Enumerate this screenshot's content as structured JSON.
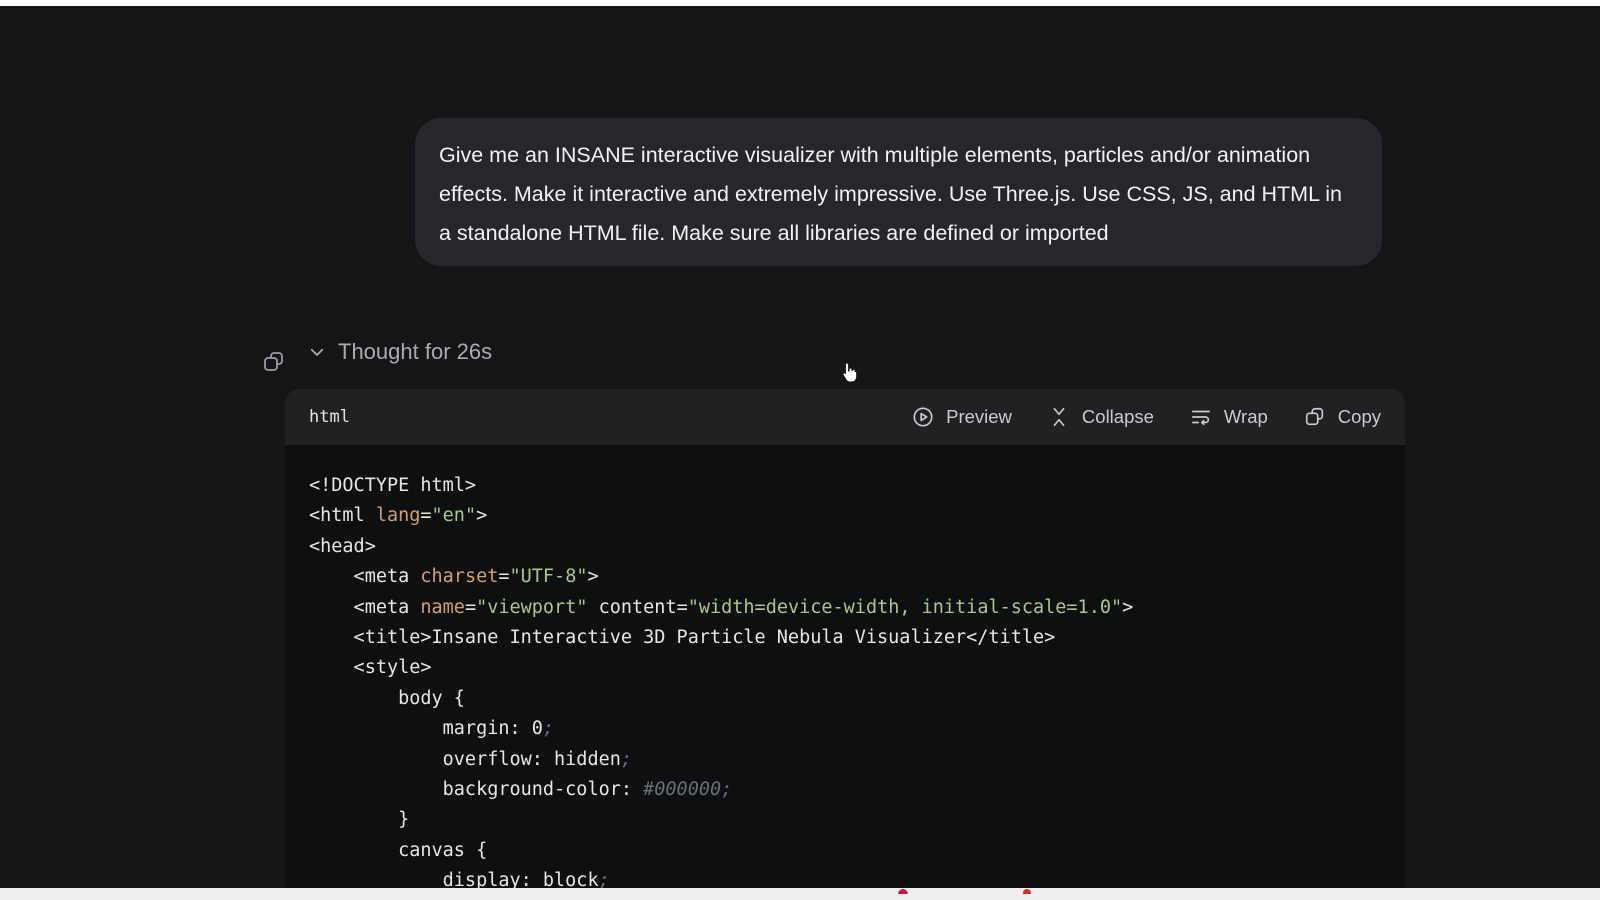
{
  "user_message": "Give me an INSANE interactive visualizer with multiple elements, particles and/or animation effects. Make it interactive and extremely impressive. Use Three.js.  Use CSS, JS, and HTML in a standalone HTML file. Make sure all libraries are defined or imported",
  "thought_label": "Thought for 26s",
  "code_block": {
    "language": "html",
    "actions": {
      "preview": "Preview",
      "collapse": "Collapse",
      "wrap": "Wrap",
      "copy": "Copy"
    },
    "lines": [
      [
        [
          "p",
          "<!DOCTYPE html>"
        ]
      ],
      [
        [
          "p",
          "<html "
        ],
        [
          "a",
          "lang"
        ],
        [
          "p",
          "="
        ],
        [
          "s",
          "\"en\""
        ],
        [
          "p",
          ">"
        ]
      ],
      [
        [
          "p",
          "<head>"
        ]
      ],
      [
        [
          "p",
          "    <meta "
        ],
        [
          "a",
          "charset"
        ],
        [
          "p",
          "="
        ],
        [
          "s",
          "\"UTF-8\""
        ],
        [
          "p",
          ">"
        ]
      ],
      [
        [
          "p",
          "    <meta "
        ],
        [
          "a",
          "name"
        ],
        [
          "p",
          "="
        ],
        [
          "s",
          "\"viewport\""
        ],
        [
          "p",
          " content="
        ],
        [
          "s",
          "\"width=device-width, initial-scale=1.0\""
        ],
        [
          "p",
          ">"
        ]
      ],
      [
        [
          "p",
          "    <title>Insane Interactive 3D Particle Nebula Visualizer</title>"
        ]
      ],
      [
        [
          "p",
          "    <style>"
        ]
      ],
      [
        [
          "p",
          "        body {"
        ]
      ],
      [
        [
          "p",
          "            margin: 0"
        ],
        [
          "c",
          ";"
        ]
      ],
      [
        [
          "p",
          "            overflow: hidden"
        ],
        [
          "c",
          ";"
        ]
      ],
      [
        [
          "p",
          "            background-color: "
        ],
        [
          "c",
          "#000000;"
        ]
      ],
      [
        [
          "p",
          "        }"
        ]
      ],
      [
        [
          "p",
          "        canvas {"
        ]
      ],
      [
        [
          "p",
          "            display: block"
        ],
        [
          "c",
          ";"
        ]
      ]
    ]
  }
}
